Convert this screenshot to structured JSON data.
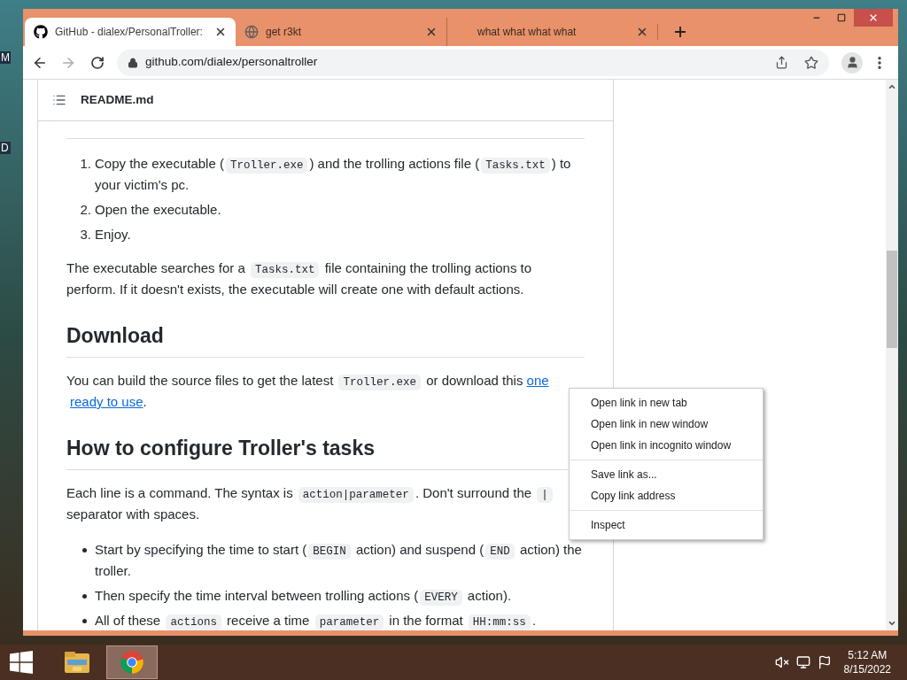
{
  "desktop": {
    "icon_labels": [
      "M",
      "D"
    ]
  },
  "browser": {
    "tabs": [
      {
        "title": "GitHub - dialex/PersonalTroller:",
        "selected": true,
        "kind": "github"
      },
      {
        "title": "get r3kt",
        "selected": false,
        "kind": "web"
      },
      {
        "title": "what what what what",
        "selected": false,
        "kind": "blank"
      }
    ],
    "url": "github.com/dialex/personaltroller"
  },
  "readme": {
    "file_name": "README.md",
    "blocks": [
      {
        "kind": "rule"
      },
      {
        "kind": "ol",
        "items": [
          {
            "marker": "1.",
            "segments": [
              {
                "kind": "text",
                "text": "Copy the executable ("
              },
              {
                "kind": "code",
                "text": "Troller.exe"
              },
              {
                "kind": "text",
                "text": ") and the trolling actions file ("
              },
              {
                "kind": "code",
                "text": "Tasks.txt"
              },
              {
                "kind": "text",
                "text": ") to your victim's pc."
              }
            ]
          },
          {
            "marker": "2.",
            "segments": [
              {
                "kind": "text",
                "text": "Open the executable."
              }
            ]
          },
          {
            "marker": "3.",
            "segments": [
              {
                "kind": "text",
                "text": "Enjoy."
              }
            ]
          }
        ]
      },
      {
        "kind": "p",
        "segments": [
          {
            "kind": "text",
            "text": "The executable searches for a "
          },
          {
            "kind": "code",
            "text": "Tasks.txt"
          },
          {
            "kind": "text",
            "text": " file containing the trolling actions to perform. If it doesn't exists, the executable will create one with default actions."
          }
        ]
      },
      {
        "kind": "heading",
        "text": "Download"
      },
      {
        "kind": "p",
        "segments": [
          {
            "kind": "text",
            "text": "You can build the source files to get the latest "
          },
          {
            "kind": "code",
            "text": "Troller.exe"
          },
          {
            "kind": "text",
            "text": " or download this "
          },
          {
            "kind": "link",
            "text": "one"
          },
          {
            "kind": "link",
            "text": "ready to use"
          },
          {
            "kind": "text",
            "text": "."
          }
        ]
      },
      {
        "kind": "heading",
        "text": "How to configure Troller's tasks"
      },
      {
        "kind": "p",
        "segments": [
          {
            "kind": "text",
            "text": "Each line is a command. The syntax is "
          },
          {
            "kind": "code",
            "text": "action|parameter"
          },
          {
            "kind": "text",
            "text": ". Don't surround the "
          },
          {
            "kind": "code",
            "text": "|"
          },
          {
            "kind": "text",
            "text": " separator with spaces."
          }
        ]
      },
      {
        "kind": "ul",
        "items": [
          {
            "segments": [
              {
                "kind": "text",
                "text": "Start by specifying the time to start ("
              },
              {
                "kind": "code",
                "text": "BEGIN"
              },
              {
                "kind": "text",
                "text": " action) and suspend ("
              },
              {
                "kind": "code",
                "text": "END"
              },
              {
                "kind": "text",
                "text": " action) the troller."
              }
            ]
          },
          {
            "segments": [
              {
                "kind": "text",
                "text": "Then specify the time interval between trolling actions ("
              },
              {
                "kind": "code",
                "text": "EVERY"
              },
              {
                "kind": "text",
                "text": " action)."
              }
            ]
          },
          {
            "segments": [
              {
                "kind": "text",
                "text": "All of these "
              },
              {
                "kind": "code",
                "text": "actions"
              },
              {
                "kind": "text",
                "text": " receive a time "
              },
              {
                "kind": "code",
                "text": "parameter"
              },
              {
                "kind": "text",
                "text": " in the format "
              },
              {
                "kind": "code",
                "text": "HH:mm:ss"
              },
              {
                "kind": "text",
                "text": "."
              }
            ]
          }
        ]
      }
    ]
  },
  "context_menu": {
    "groups": [
      [
        "Open link in new tab",
        "Open link in new window",
        "Open link in incognito window"
      ],
      [
        "Save link as...",
        "Copy link address"
      ],
      [
        "Inspect"
      ]
    ]
  },
  "taskbar": {
    "apps": [
      {
        "kind": "explorer",
        "selected": false
      },
      {
        "kind": "chrome",
        "selected": true
      }
    ],
    "time": "5:12 AM",
    "date": "8/15/2022"
  }
}
